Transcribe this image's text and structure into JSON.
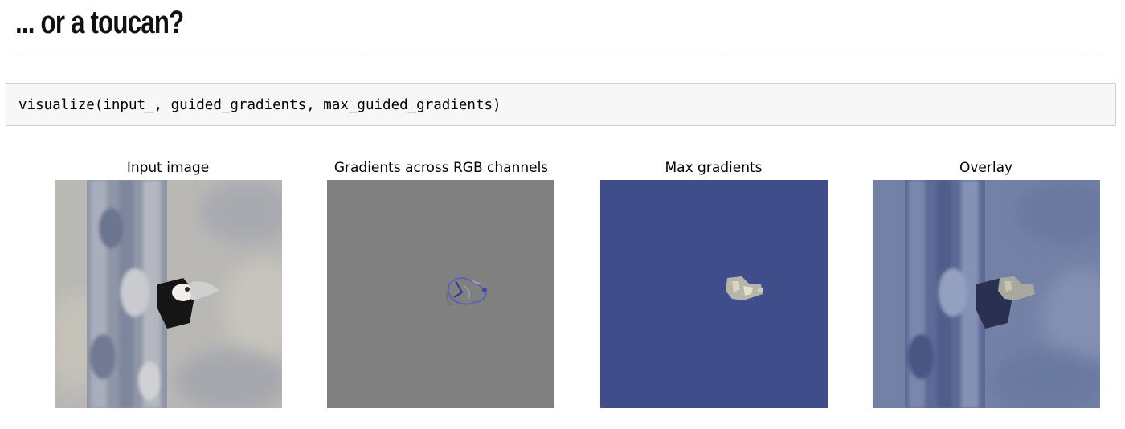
{
  "section": {
    "heading": "... or a toucan?"
  },
  "code_cell": {
    "source": "visualize(input_, guided_gradients, max_guided_gradients)"
  },
  "output": {
    "panels": [
      {
        "title": "Input image",
        "image_icon": "toucan-photo"
      },
      {
        "title": "Gradients across RGB channels",
        "image_icon": "gradient-map"
      },
      {
        "title": "Max gradients",
        "image_icon": "max-gradient-map"
      },
      {
        "title": "Overlay",
        "image_icon": "overlay-photo"
      }
    ]
  },
  "colors": {
    "code_background": "#f7f7f7",
    "gradient_gray": "#808080",
    "max_gradient_blue": "#3f4e8a"
  }
}
